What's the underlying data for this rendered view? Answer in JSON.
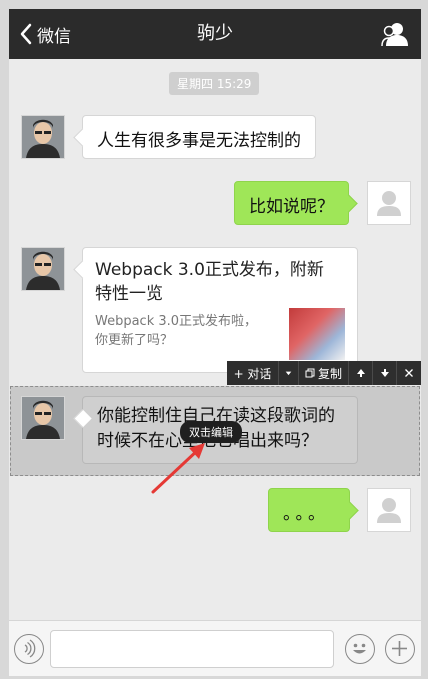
{
  "header": {
    "back_label": "微信",
    "title": "驹少"
  },
  "timestamp": "星期四 15:29",
  "messages": [
    {
      "side": "left",
      "text": "人生有很多事是无法控制的"
    },
    {
      "side": "right",
      "text": "比如说呢？"
    },
    {
      "side": "left",
      "type": "link",
      "title": "Webpack 3.0正式发布，附新特性一览",
      "title_line1": "Webpack 3.0正式发布，附新",
      "title_line2": "特性一览",
      "desc_line1": "Webpack 3.0正式发布啦，",
      "desc_line2": "你更新了吗？"
    },
    {
      "side": "left",
      "text_line1": "你能控制住自己在读这段歌词的",
      "text_line2": "时候不在心里把它唱出来吗？"
    },
    {
      "side": "right",
      "text": "。。。"
    }
  ],
  "toolbar": {
    "dialog_label": "+ 对话",
    "copy_label": "复制"
  },
  "tooltip": "双击编辑",
  "colors": {
    "header_bg": "#2b2b2b",
    "right_bubble": "#9fe658",
    "annotation_arrow": "#e53935"
  },
  "icons": [
    "chevron-left-icon",
    "contacts-icon",
    "dropdown-caret-icon",
    "copy-icon",
    "arrow-up-icon",
    "arrow-down-icon",
    "close-icon",
    "voice-icon",
    "emoji-icon",
    "plus-icon",
    "default-avatar-icon"
  ]
}
